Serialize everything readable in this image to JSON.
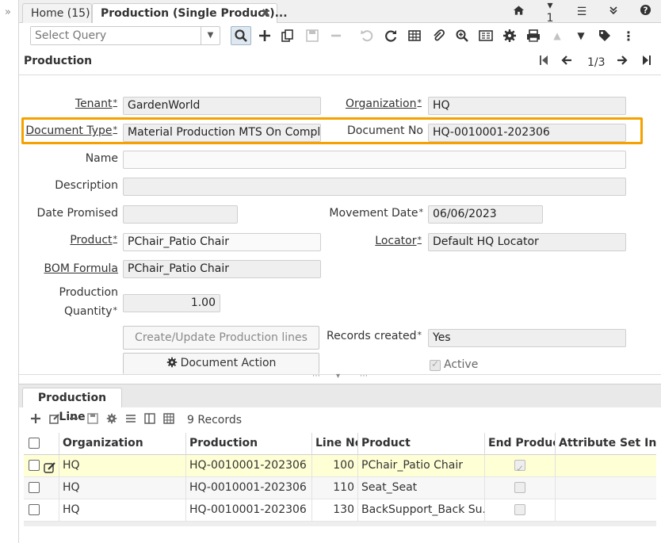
{
  "tabs": [
    {
      "label": "Home (15)"
    },
    {
      "label": "Production (Single Product)..."
    }
  ],
  "tab_tools": {
    "windows_count": "1"
  },
  "toolbar": {
    "query_placeholder": "Select Query"
  },
  "window": {
    "title": "Production",
    "record_nav": "1/3"
  },
  "form": {
    "tenant": {
      "label": "Tenant",
      "value": "GardenWorld"
    },
    "organization": {
      "label": "Organization",
      "value": "HQ"
    },
    "document_type": {
      "label": "Document Type",
      "value": "Material Production MTS On Complete"
    },
    "document_no": {
      "label": "Document No",
      "value": "HQ-0010001-202306"
    },
    "name": {
      "label": "Name",
      "value": ""
    },
    "description": {
      "label": "Description",
      "value": ""
    },
    "date_promised": {
      "label": "Date Promised",
      "value": ""
    },
    "movement_date": {
      "label": "Movement Date",
      "value": "06/06/2023"
    },
    "product": {
      "label": "Product",
      "value": "PChair_Patio Chair"
    },
    "locator": {
      "label": "Locator",
      "value": "Default HQ Locator"
    },
    "bom_formula": {
      "label": "BOM Formula",
      "value": "PChair_Patio Chair"
    },
    "production_quantity": {
      "label_line1": "Production",
      "label_line2": "Quantity",
      "value": "1.00"
    },
    "create_update_button": "Create/Update Production lines",
    "records_created": {
      "label": "Records created",
      "value": "Yes"
    },
    "document_action_button": "Document Action",
    "active": {
      "label": "Active",
      "checked": true
    }
  },
  "detail": {
    "tab_label": "Production Line",
    "records": "9 Records",
    "columns": [
      "Organization",
      "Production",
      "Line No",
      "Product",
      "End Product",
      "Attribute Set Insta"
    ],
    "rows": [
      {
        "org": "HQ",
        "production": "HQ-0010001-202306",
        "line_no": "100",
        "product": "PChair_Patio Chair",
        "end_product": true
      },
      {
        "org": "HQ",
        "production": "HQ-0010001-202306",
        "line_no": "110",
        "product": "Seat_Seat",
        "end_product": false
      },
      {
        "org": "HQ",
        "production": "HQ-0010001-202306",
        "line_no": "130",
        "product": "BackSupport_Back Su...",
        "end_product": false
      }
    ]
  },
  "colors": {
    "highlight": "#f5a100",
    "selected_row": "#ffffd6"
  }
}
